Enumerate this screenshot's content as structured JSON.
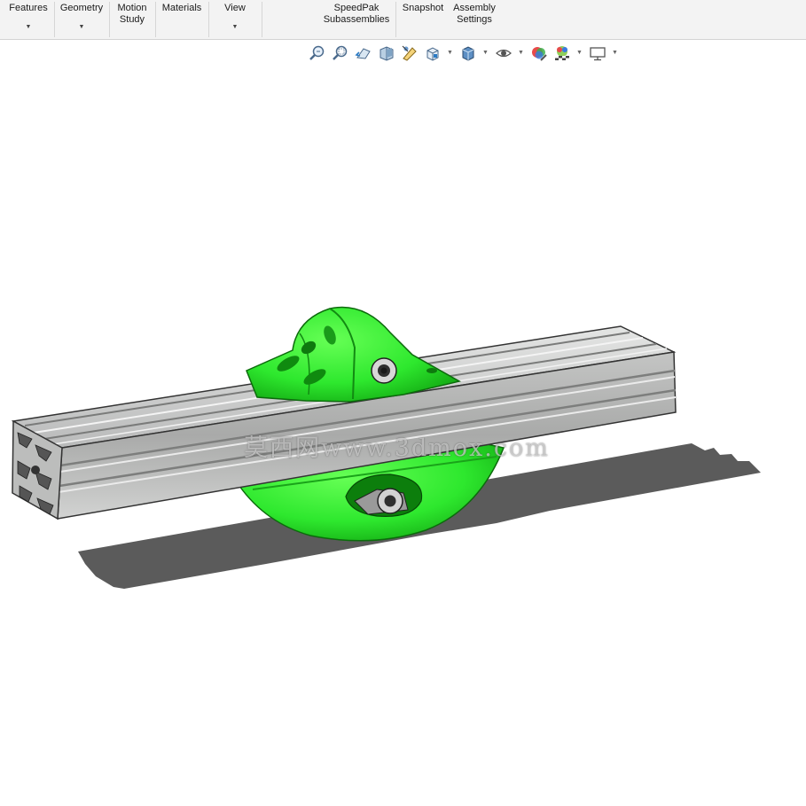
{
  "ribbon": {
    "features": "Features",
    "geometry": "Geometry",
    "motion_study_1": "Motion",
    "motion_study_2": "Study",
    "materials": "Materials",
    "view": "View",
    "speedpak_1": "SpeedPak",
    "speedpak_2": "Subassemblies",
    "snapshot": "Snapshot",
    "assembly_settings_1": "Assembly",
    "assembly_settings_2": "Settings"
  },
  "heads_up_toolbar": {
    "icons": [
      "zoom-to-fit-icon",
      "zoom-to-area-icon",
      "previous-view-icon",
      "section-view-icon",
      "dynamic-annotation-icon",
      "view-orientation-icon",
      "display-style-icon",
      "hide-show-icon",
      "edit-appearance-icon",
      "apply-scene-icon",
      "view-settings-icon"
    ]
  },
  "watermark": "莫西网www.3dmox.com",
  "colors": {
    "part_green": "#2ee82e",
    "profile_gray": "#c8c9c8",
    "ribbon_bg": "#f3f3f3"
  }
}
